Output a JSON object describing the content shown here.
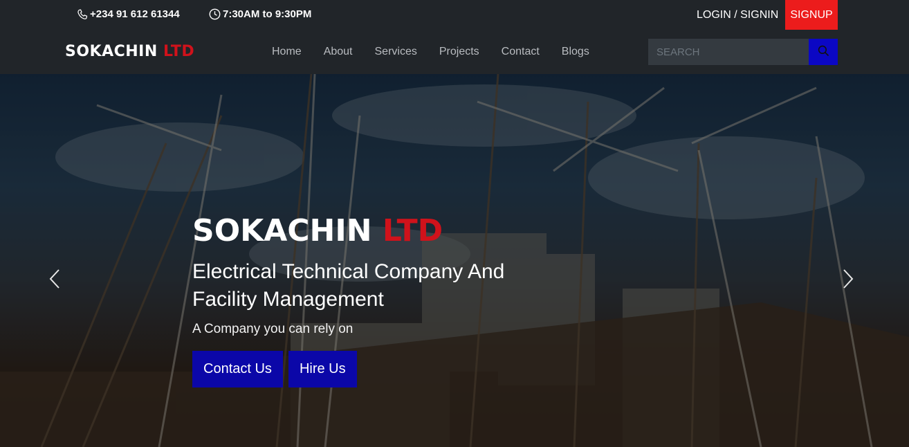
{
  "topbar": {
    "phone": "+234 91 612 61344",
    "hours": "7:30AM to 9:30PM",
    "login_label": "LOGIN / SIGNIN",
    "signup_label": "SIGNUP"
  },
  "brand": {
    "name": "SOKACHIN",
    "suffix": "LTD"
  },
  "nav": {
    "items": [
      {
        "label": "Home"
      },
      {
        "label": "About"
      },
      {
        "label": "Services"
      },
      {
        "label": "Projects"
      },
      {
        "label": "Contact"
      },
      {
        "label": "Blogs"
      }
    ]
  },
  "search": {
    "placeholder": "SEARCH",
    "icon": "search-icon"
  },
  "hero": {
    "title_main": "SOKACHIN",
    "title_accent": "LTD",
    "subtitle": "Electrical Technical Company And Facility Management",
    "tagline": "A Company you can rely on",
    "buttons": {
      "contact_label": "Contact Us",
      "hire_label": "Hire Us"
    },
    "prev_icon": "chevron-left-icon",
    "next_icon": "chevron-right-icon"
  },
  "colors": {
    "accent_red": "#d0121b",
    "signup_red": "#ec1c1c",
    "button_blue": "#0b07a8",
    "search_blue": "#0b07c4",
    "bar_background": "#212529"
  }
}
